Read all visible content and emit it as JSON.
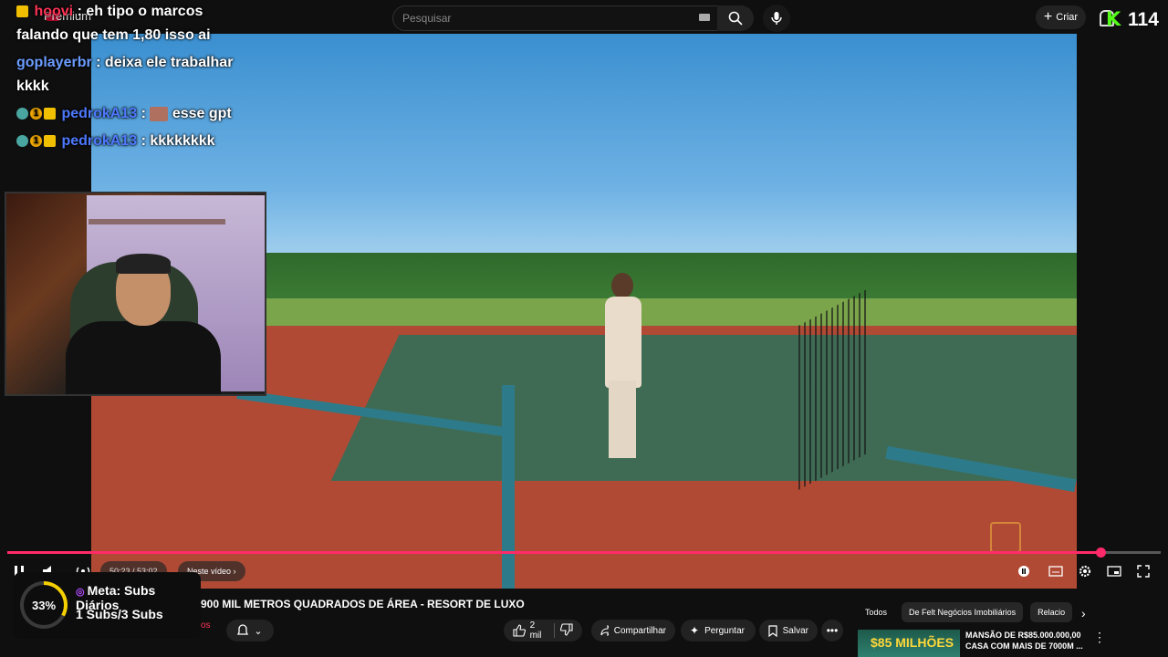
{
  "topbar": {
    "premium_label": "Premium",
    "search_placeholder": "Pesquisar",
    "create_label": "Criar",
    "kick_logo": "K",
    "kick_count": "114"
  },
  "chat": [
    {
      "user": "hoovi",
      "text": ": eh tipo o marcos falando que tem 1,80 isso ai"
    },
    {
      "user": "goplayerbr",
      "text": ": deixa ele trabalhar kkkk"
    },
    {
      "user": "pedrokA13",
      "text": "esse gpt",
      "sep": ":",
      "badge_num": "1"
    },
    {
      "user": "pedrokA13",
      "text": ": kkkkkkkk",
      "badge_num": "1"
    }
  ],
  "player": {
    "progress_fraction": 0.948,
    "time": "50:23 / 53:02",
    "chapter_label": "Neste vídeo"
  },
  "goal": {
    "percent": "33%",
    "fraction": 0.33,
    "title": "Meta: Subs Diários",
    "progress_text": "1 Subs/3 Subs"
  },
  "video": {
    "title": "900 MIL METROS QUADRADOS DE ÁREA - RESORT DE LUXO",
    "channel_fragment": "os",
    "like_count": "2 mil",
    "share_label": "Compartilhar",
    "ask_label": "Perguntar",
    "save_label": "Salvar"
  },
  "sidebar": {
    "chips": [
      "Todos",
      "De Felt Negócios Imobiliários",
      "Relacio"
    ],
    "rec_thumb_text": "$85 MILHÕES",
    "rec_title": "MANSÃO DE R$85.000.000,00 CASA COM MAIS DE 7000M ..."
  },
  "colors": {
    "accent": "#ff2a6a",
    "goal_ring": "#f5d000",
    "kick_green": "#53fc18"
  }
}
